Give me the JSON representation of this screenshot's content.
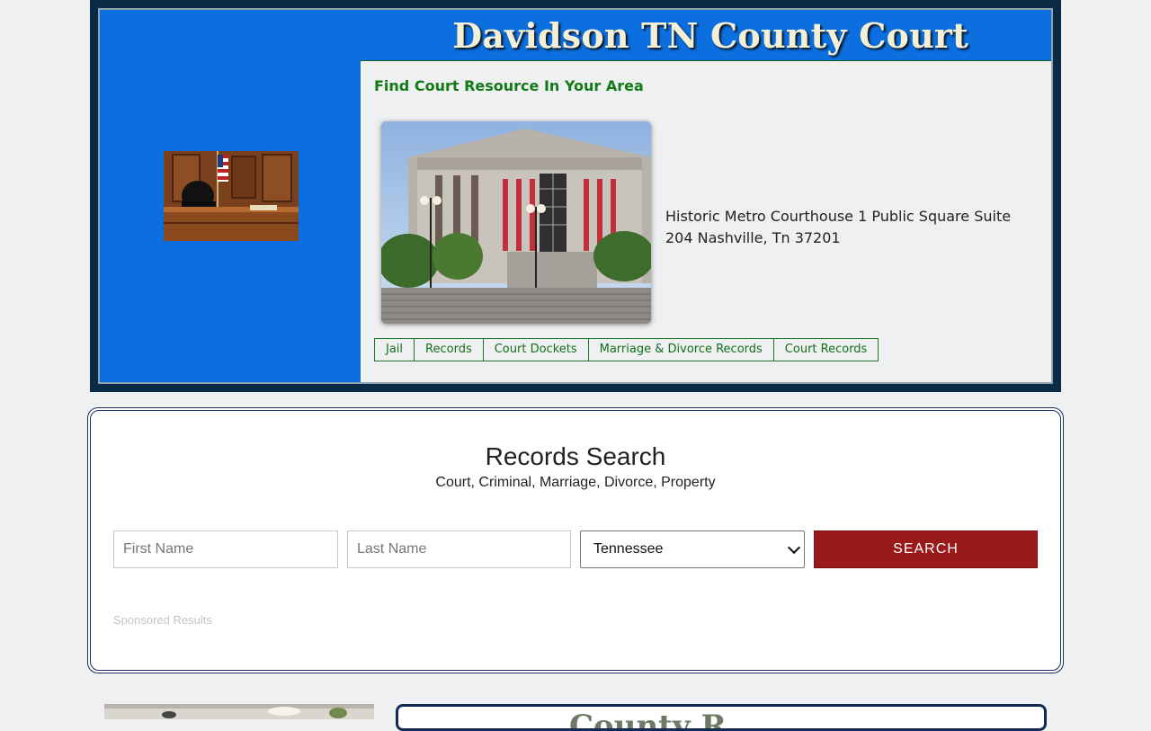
{
  "site": {
    "title": "Davidson TN County Court",
    "subtitle": "Find Court Resource In Your Area",
    "address": "Historic Metro Courthouse 1 Public Square Suite 204 Nashville, Tn 37201"
  },
  "tabs": [
    {
      "label": "Jail"
    },
    {
      "label": "Records"
    },
    {
      "label": "Court Dockets"
    },
    {
      "label": "Marriage & Divorce Records"
    },
    {
      "label": "Court Records"
    }
  ],
  "search": {
    "title": "Records Search",
    "subtitle": "Court, Criminal, Marriage, Divorce, Property",
    "first_name_placeholder": "First Name",
    "last_name_placeholder": "Last Name",
    "state_selected": "Tennessee",
    "button_label": "SEARCH",
    "sponsored": "Sponsored Results"
  },
  "bottom": {
    "card_title_partial": "County R"
  },
  "colors": {
    "page_bg": "#eff0f1",
    "header_frame": "#0b2a44",
    "brand_blue": "#0b6fe0",
    "title_text": "#f4f0d8",
    "link_green": "#126f1a",
    "search_button": "#9a1a1c"
  }
}
